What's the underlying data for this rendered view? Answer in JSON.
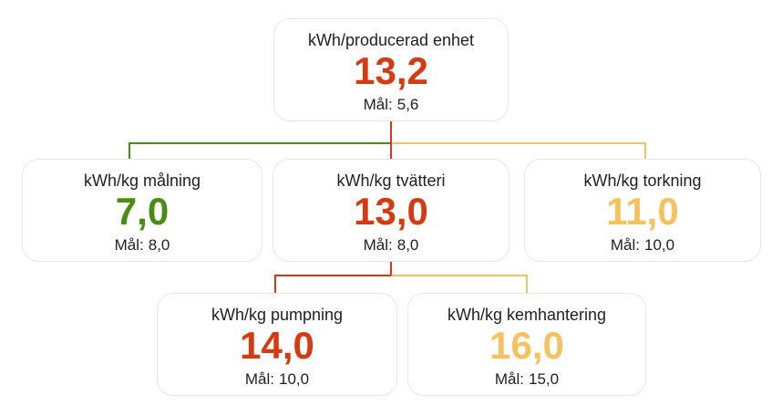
{
  "colors": {
    "red": "#d63a12",
    "green": "#4b8d12",
    "yellow": "#f7c25e"
  },
  "goal_label": "Mål:",
  "nodes": {
    "root": {
      "title": "kWh/producerad enhet",
      "value": "13,2",
      "goal": "5,6",
      "status": "red"
    },
    "malning": {
      "title": "kWh/kg målning",
      "value": "7,0",
      "goal": "8,0",
      "status": "green"
    },
    "tvatteri": {
      "title": "kWh/kg tvätteri",
      "value": "13,0",
      "goal": "8,0",
      "status": "red"
    },
    "torkning": {
      "title": "kWh/kg torkning",
      "value": "11,0",
      "goal": "10,0",
      "status": "yellow"
    },
    "pumpning": {
      "title": "kWh/kg pumpning",
      "value": "14,0",
      "goal": "10,0",
      "status": "red"
    },
    "kemhantering": {
      "title": "kWh/kg kemhantering",
      "value": "16,0",
      "goal": "15,0",
      "status": "yellow"
    }
  },
  "tree": [
    {
      "parent": "root",
      "child": "malning"
    },
    {
      "parent": "root",
      "child": "tvatteri"
    },
    {
      "parent": "root",
      "child": "torkning"
    },
    {
      "parent": "tvatteri",
      "child": "pumpning"
    },
    {
      "parent": "tvatteri",
      "child": "kemhantering"
    }
  ]
}
